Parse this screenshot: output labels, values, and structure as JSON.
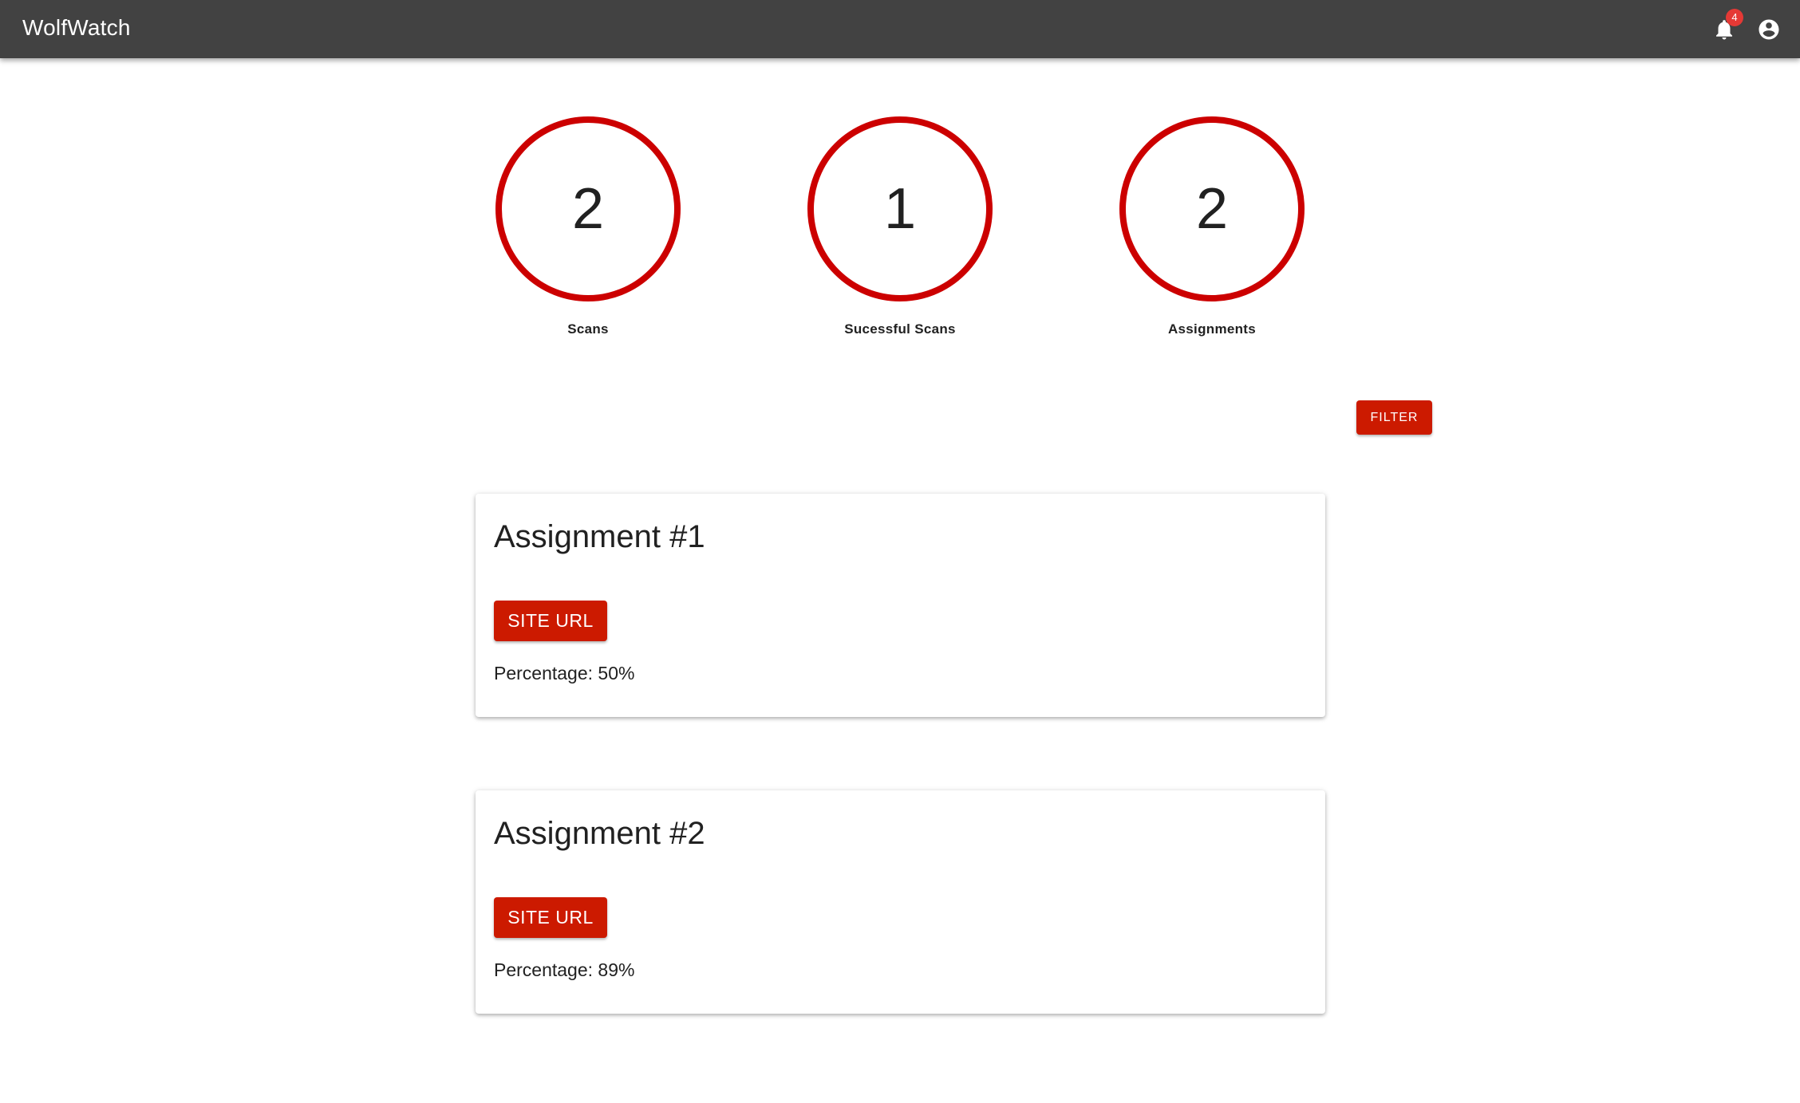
{
  "appbar": {
    "title": "WolfWatch",
    "notification_count": "4",
    "bell_icon": "notifications-bell-icon",
    "account_icon": "account-circle-icon",
    "background_color": "#424242"
  },
  "stats": [
    {
      "value": "2",
      "label": "Scans"
    },
    {
      "value": "1",
      "label": "Sucessful Scans"
    },
    {
      "value": "2",
      "label": "Assignments"
    }
  ],
  "filter": {
    "label": "FILTER"
  },
  "assignments": [
    {
      "title": "Assignment #1",
      "button_label": "SITE URL",
      "percentage": "Percentage: 50%"
    },
    {
      "title": "Assignment #2",
      "button_label": "SITE URL",
      "percentage": "Percentage: 89%"
    }
  ],
  "colors": {
    "accent": "#cc1a00",
    "ring": "#cc0000",
    "badge": "#e53935"
  }
}
